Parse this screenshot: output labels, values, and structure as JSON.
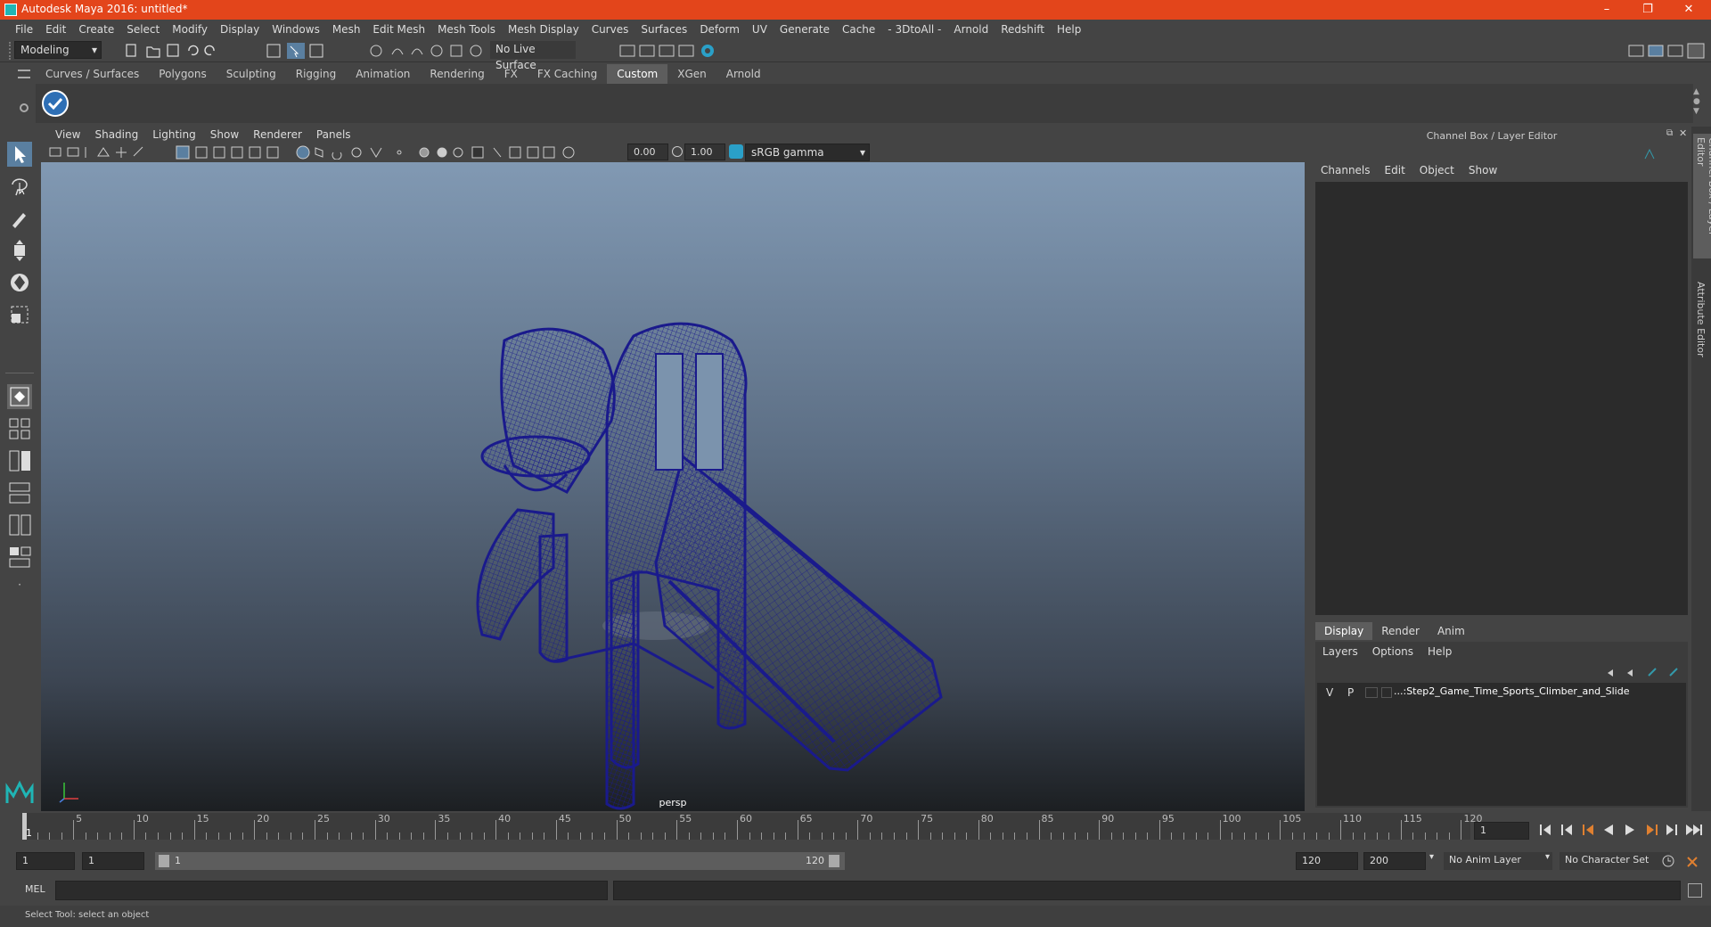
{
  "window": {
    "title": "Autodesk Maya 2016: untitled*",
    "min_icon": "minimize-icon",
    "max_icon": "restore-icon",
    "close_icon": "close-icon",
    "min_glyph": "–",
    "max_glyph": "❐",
    "close_glyph": "✕"
  },
  "menubar": [
    "File",
    "Edit",
    "Create",
    "Select",
    "Modify",
    "Display",
    "Windows",
    "Mesh",
    "Edit Mesh",
    "Mesh Tools",
    "Mesh Display",
    "Curves",
    "Surfaces",
    "Deform",
    "UV",
    "Generate",
    "Cache",
    "- 3DtoAll -",
    "Arnold",
    "Redshift",
    "Help"
  ],
  "statusline": {
    "mode": "Modeling",
    "live_surface": "No Live Surface"
  },
  "shelf_tabs": [
    "Curves / Surfaces",
    "Polygons",
    "Sculpting",
    "Rigging",
    "Animation",
    "Rendering",
    "FX",
    "FX Caching",
    "Custom",
    "XGen",
    "Arnold"
  ],
  "shelf_active": "Custom",
  "panel_menu": [
    "View",
    "Shading",
    "Lighting",
    "Show",
    "Renderer",
    "Panels"
  ],
  "panel_toolbar": {
    "exposure": "0.00",
    "gamma": "1.00",
    "color_space": "sRGB gamma"
  },
  "viewport": {
    "camera_label": "persp"
  },
  "channel_box": {
    "title": "Channel Box / Layer Editor",
    "menu": [
      "Channels",
      "Edit",
      "Object",
      "Show"
    ]
  },
  "layer_editor": {
    "tabs": [
      "Display",
      "Render",
      "Anim"
    ],
    "active_tab": "Display",
    "menu": [
      "Layers",
      "Options",
      "Help"
    ],
    "layers": [
      {
        "v": "V",
        "p": "P",
        "name": "...:Step2_Game_Time_Sports_Climber_and_Slide"
      }
    ]
  },
  "side_tabs": [
    "Channel Box / Layer Editor",
    "Attribute Editor"
  ],
  "timeline": {
    "ticks": [
      "5",
      "10",
      "15",
      "20",
      "25",
      "30",
      "35",
      "40",
      "45",
      "50",
      "55",
      "60",
      "65",
      "70",
      "75",
      "80",
      "85",
      "90",
      "95",
      "100",
      "105",
      "110",
      "115",
      "120"
    ],
    "current_marker": "1",
    "current_frame": "1"
  },
  "range": {
    "start": "1",
    "playback_start": "1",
    "slider_start": "1",
    "slider_end": "120",
    "playback_end": "120",
    "end": "200",
    "anim_layer": "No Anim Layer",
    "character_set": "No Character Set"
  },
  "command_line": {
    "label": "MEL"
  },
  "help_line": "Select Tool: select an object",
  "colors": {
    "titlebar": "#e3451b",
    "wireframe": "#1a1a8c",
    "background": "#444444"
  }
}
